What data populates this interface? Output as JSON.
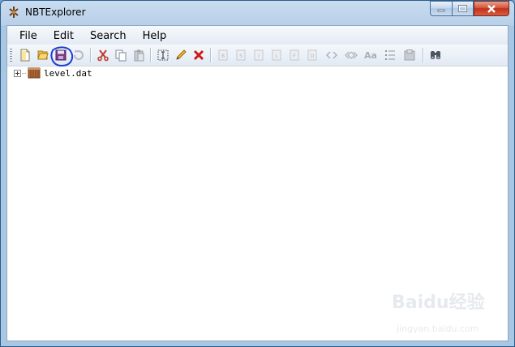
{
  "window": {
    "title": "NBTExplorer"
  },
  "menu": {
    "items": [
      {
        "label": "File"
      },
      {
        "label": "Edit"
      },
      {
        "label": "Search"
      },
      {
        "label": "Help"
      }
    ]
  },
  "toolbar": {
    "buttons": [
      {
        "icon": "new-file-icon",
        "enabled": true
      },
      {
        "icon": "open-folder-icon",
        "enabled": true
      },
      {
        "icon": "save-icon",
        "enabled": true
      },
      {
        "icon": "refresh-icon",
        "enabled": false
      },
      {
        "icon": "cut-icon",
        "enabled": true
      },
      {
        "icon": "copy-icon",
        "enabled": true
      },
      {
        "icon": "paste-icon",
        "enabled": false
      },
      {
        "icon": "rename-icon",
        "enabled": true
      },
      {
        "icon": "edit-icon",
        "enabled": true
      },
      {
        "icon": "delete-icon",
        "enabled": true
      },
      {
        "icon": "add-byte-tag-icon",
        "enabled": false
      },
      {
        "icon": "add-short-tag-icon",
        "enabled": false
      },
      {
        "icon": "add-int-tag-icon",
        "enabled": false
      },
      {
        "icon": "add-long-tag-icon",
        "enabled": false
      },
      {
        "icon": "add-float-tag-icon",
        "enabled": false
      },
      {
        "icon": "add-double-tag-icon",
        "enabled": false
      },
      {
        "icon": "add-byte-array-tag-icon",
        "enabled": false
      },
      {
        "icon": "add-int-array-tag-icon",
        "enabled": false
      },
      {
        "icon": "add-string-tag-icon",
        "enabled": false
      },
      {
        "icon": "add-list-tag-icon",
        "enabled": false
      },
      {
        "icon": "add-compound-tag-icon",
        "enabled": false
      },
      {
        "icon": "find-icon",
        "enabled": true
      }
    ]
  },
  "tree": {
    "nodes": [
      {
        "label": "level.dat",
        "icon": "nbt-file-icon",
        "expanded": false
      }
    ]
  },
  "watermark": {
    "text": "Baidu经验",
    "sub": "jingyan.baidu.com"
  },
  "colors": {
    "accent": "#1b3fd6",
    "close": "#c4311a",
    "delete": "#d01818"
  }
}
